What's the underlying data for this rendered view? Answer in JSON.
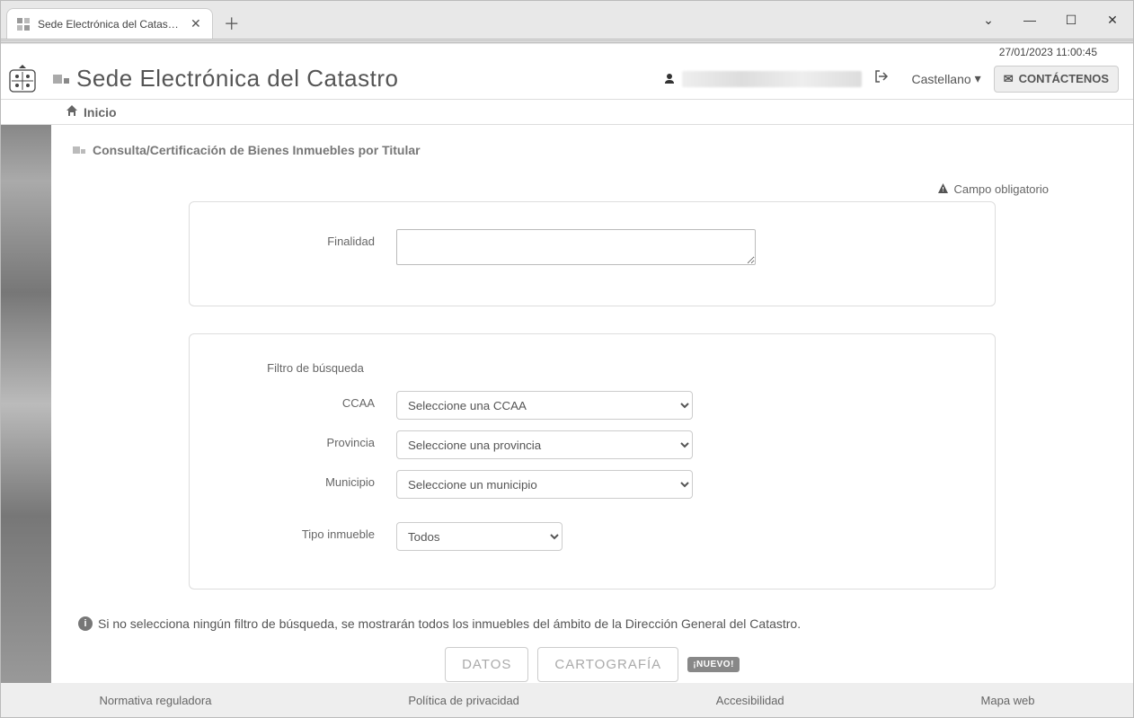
{
  "browser": {
    "tab_title": "Sede Electrónica del Catastro - C"
  },
  "timestamp": "27/01/2023  11:00:45",
  "header": {
    "site_title": "Sede Electrónica del Catastro",
    "language": "Castellano",
    "contact_label": "CONTÁCTENOS"
  },
  "breadcrumb": {
    "home": "Inicio"
  },
  "page": {
    "title": "Consulta/Certificación de Bienes Inmuebles por Titular",
    "required_note": "Campo obligatorio"
  },
  "form": {
    "finalidad_label": "Finalidad",
    "finalidad_value": "",
    "filter_title": "Filtro de búsqueda",
    "ccaa_label": "CCAA",
    "ccaa_selected": "Seleccione una CCAA",
    "provincia_label": "Provincia",
    "provincia_selected": "Seleccione una provincia",
    "municipio_label": "Municipio",
    "municipio_selected": "Seleccione un municipio",
    "tipo_label": "Tipo inmueble",
    "tipo_selected": "Todos"
  },
  "info_text": "Si no selecciona ningún filtro de búsqueda, se mostrarán todos los inmuebles del ámbito de la Dirección General del Catastro.",
  "buttons": {
    "datos": "DATOS",
    "cartografia": "CARTOGRAFÍA",
    "nuevo_badge": "¡NUEVO!"
  },
  "footer": {
    "normativa": "Normativa reguladora",
    "privacidad": "Política de privacidad",
    "accesibilidad": "Accesibilidad",
    "mapa": "Mapa web"
  }
}
